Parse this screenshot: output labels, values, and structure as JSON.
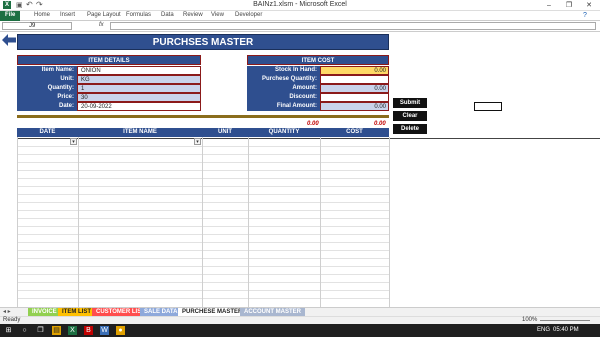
{
  "window": {
    "title": "BAINz1.xlsm - Microsoft Excel"
  },
  "ribbon": {
    "tabs": [
      "File",
      "Home",
      "Insert",
      "Page Layout",
      "Formulas",
      "Data",
      "Review",
      "View",
      "Developer"
    ]
  },
  "formula_bar": {
    "name_box": "J9",
    "fx": "fx",
    "value": ""
  },
  "banner": {
    "title": "PURCHSES MASTER"
  },
  "item_details": {
    "heading": "ITEM DETAILS",
    "fields": [
      {
        "label": "Item Name:",
        "value": "ONION"
      },
      {
        "label": "Unit:",
        "value": "KG"
      },
      {
        "label": "Quantity:",
        "value": "1"
      },
      {
        "label": "Price:",
        "value": "30"
      },
      {
        "label": "Date:",
        "value": "20-09-2022"
      }
    ]
  },
  "item_cost": {
    "heading": "ITEM COST",
    "fields": [
      {
        "label": "Stock In Hand:",
        "value": "0.00"
      },
      {
        "label": "Purchese Quantity:",
        "value": ""
      },
      {
        "label": "Amount:",
        "value": "0.00"
      },
      {
        "label": "Discount:",
        "value": ""
      },
      {
        "label": "Final Amount:",
        "value": "0.00"
      }
    ]
  },
  "buttons": {
    "submit": "Submit",
    "clear": "Clear",
    "delete": "Delete"
  },
  "totals": {
    "left": "0.00",
    "right": "0.00"
  },
  "table": {
    "headers": [
      "DATE",
      "ITEM NAME",
      "UNIT",
      "QUANTITY",
      "COST"
    ]
  },
  "sheet_tabs": [
    "INVOICE",
    "ITEM LIST",
    "CUSTOMER LIST",
    "SALE DATA",
    "PURCHESE MASTER",
    "ACCOUNT MASTER"
  ],
  "status": {
    "ready": "Ready",
    "zoom": "100%"
  },
  "taskbar": {
    "lang": "ENG",
    "time": "05:40 PM"
  },
  "colors": {
    "header_blue": "#2f4f8f",
    "excel_green": "#1d6f42",
    "stock_yellow": "#ffd966",
    "border_red": "#8b1a1a"
  }
}
